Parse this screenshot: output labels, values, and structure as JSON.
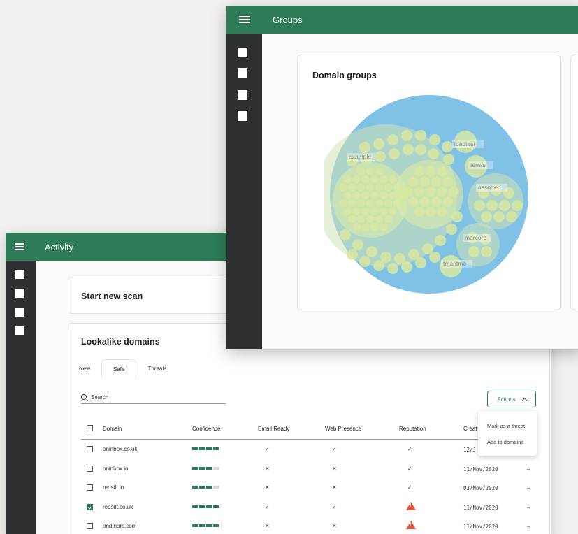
{
  "groups_window": {
    "title": "Groups",
    "card_title": "Domain groups",
    "bubble_labels": [
      "example",
      "loadtest",
      "terras",
      "assorted",
      "marcore",
      "tmaritmo"
    ]
  },
  "activity_window": {
    "title": "Activity",
    "start_scan_title": "Start new scan",
    "lookalike_title": "Lookalike domains",
    "tabs": [
      {
        "label": "New",
        "active": false
      },
      {
        "label": "Safe",
        "active": true
      },
      {
        "label": "Threats",
        "active": false
      }
    ],
    "search_placeholder": "Search",
    "actions_label": "Actions",
    "actions_menu": [
      "Mark as a threat",
      "Add to domains"
    ],
    "columns": [
      "Domain",
      "Confidence",
      "Email Ready",
      "Web Presence",
      "Reputation",
      "Creat"
    ],
    "rows": [
      {
        "checked": false,
        "domain": "oninbox.co.uk",
        "confidence": 4,
        "email": "✓",
        "web": "✓",
        "reputation": "✓",
        "created": "12/J",
        "arrow": "→"
      },
      {
        "checked": false,
        "domain": "oninbox.io",
        "confidence": 3,
        "email": "✕",
        "web": "✕",
        "reputation": "✓",
        "created": "11/Nov/2020",
        "arrow": "→"
      },
      {
        "checked": false,
        "domain": "redsift.io",
        "confidence": 3,
        "email": "✕",
        "web": "✕",
        "reputation": "✓",
        "created": "03/Nov/2020",
        "arrow": "→"
      },
      {
        "checked": true,
        "domain": "redsift.co.uk",
        "confidence": 4,
        "email": "✓",
        "web": "✓",
        "reputation": "warning",
        "created": "11/Nov/2020",
        "arrow": "→"
      },
      {
        "checked": false,
        "domain": "ondmarc.com",
        "confidence": 4,
        "email": "✕",
        "web": "✕",
        "reputation": "warning",
        "created": "11/Nov/2020",
        "arrow": "→"
      }
    ]
  },
  "colors": {
    "brand_green": "#2e7c5a",
    "sidebar": "#2d2f31",
    "bubble_outer": "#80c1e6",
    "bubble_inner": "#d9e8a0",
    "warning": "#e0533c"
  }
}
